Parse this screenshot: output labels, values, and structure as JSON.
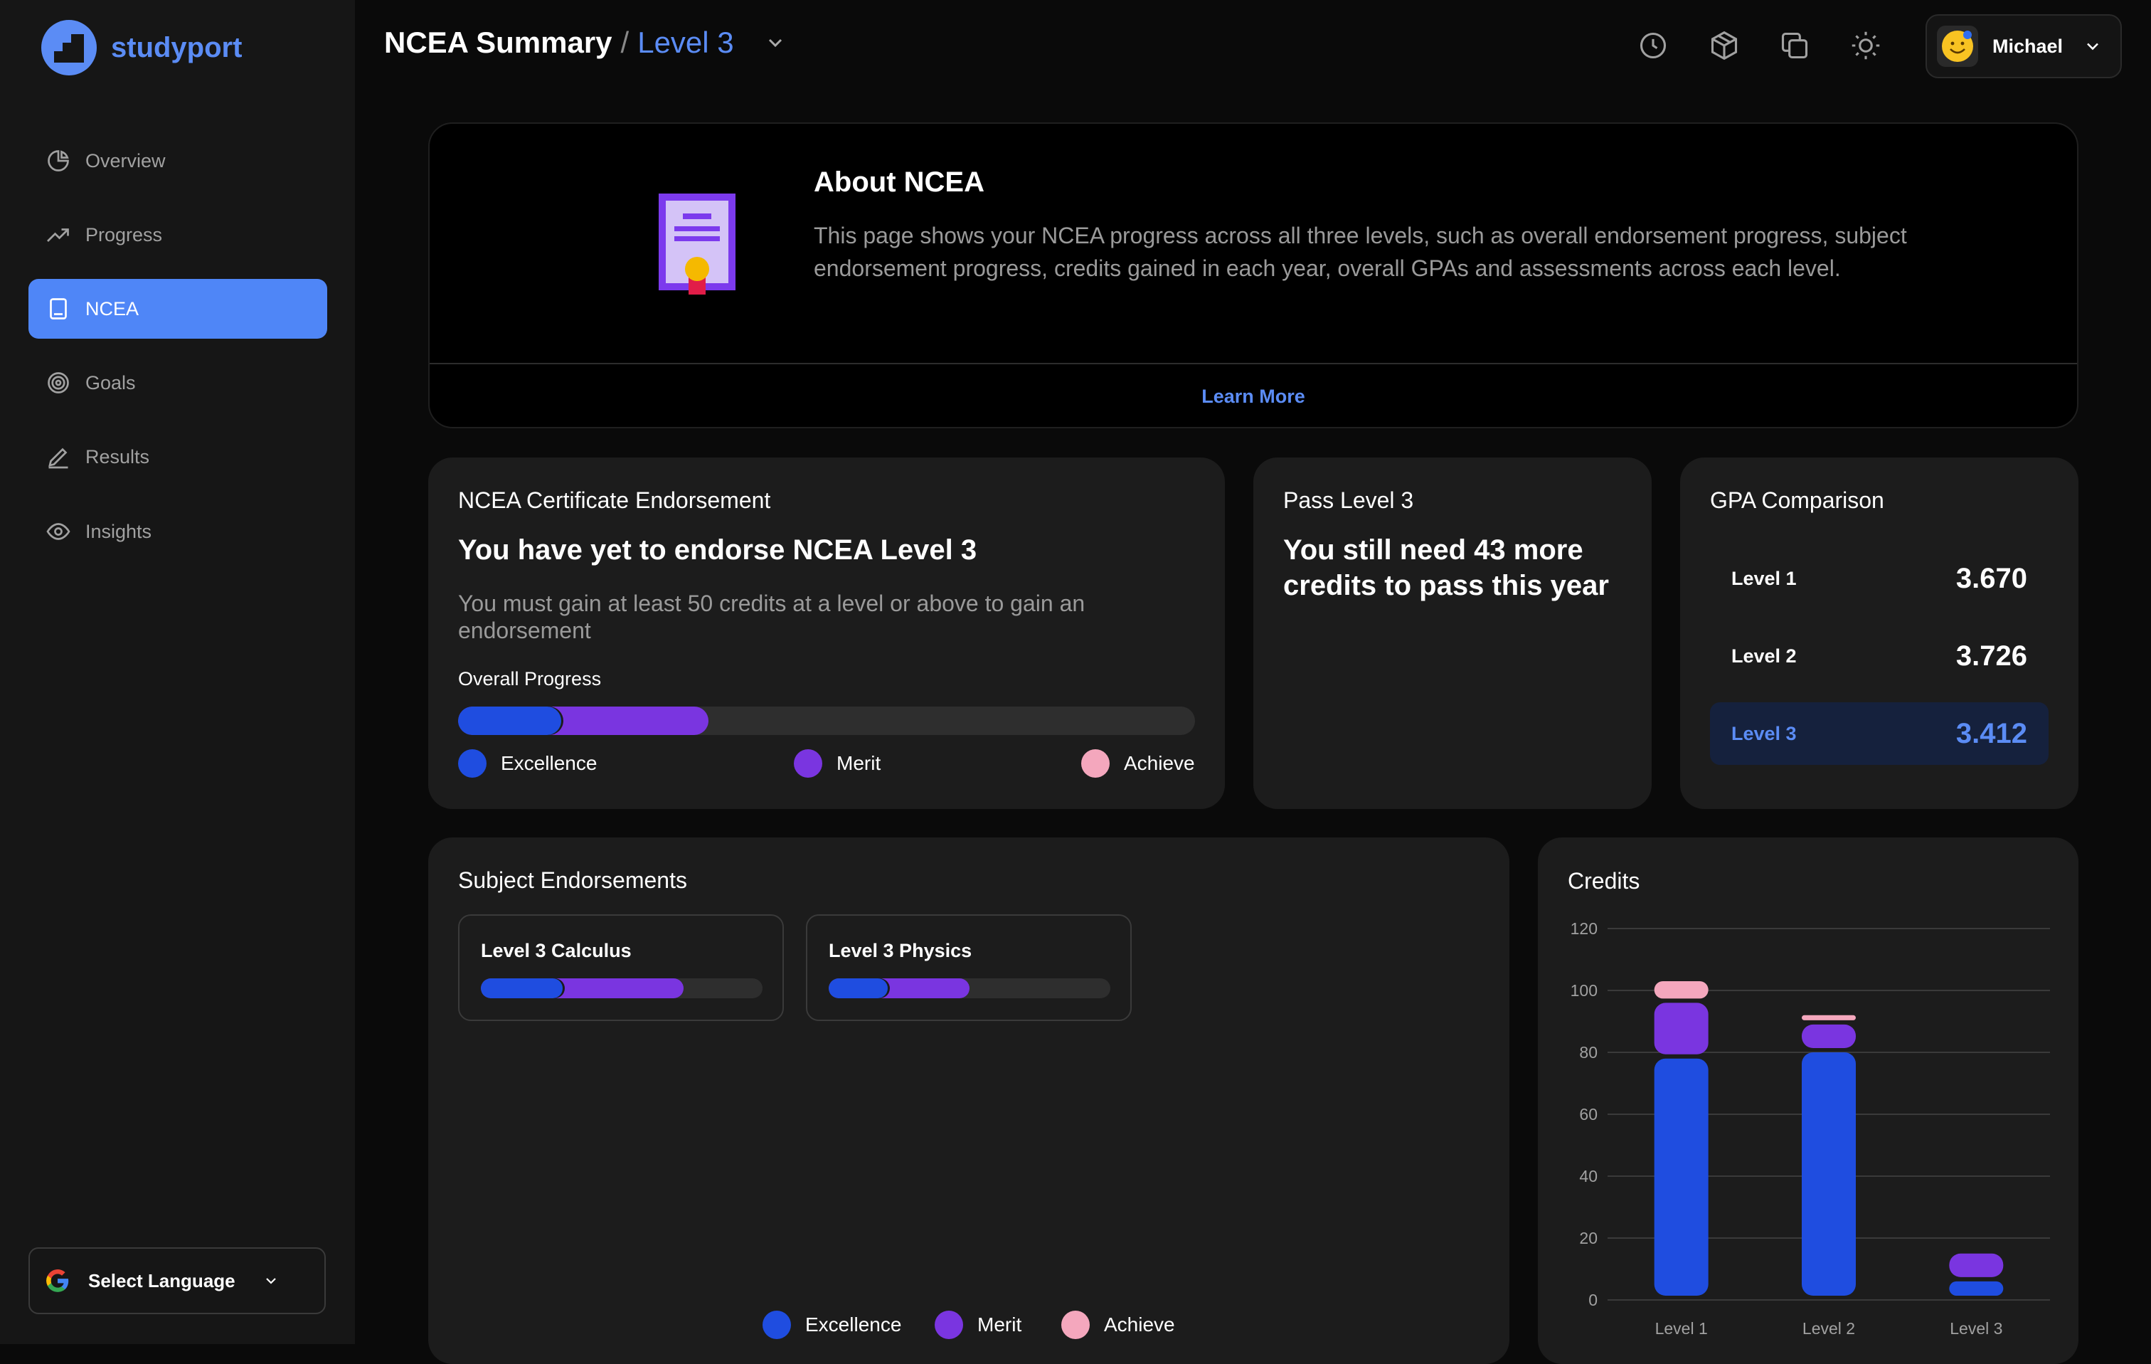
{
  "brand": {
    "name": "studyport"
  },
  "sidebar": {
    "items": [
      {
        "label": "Overview",
        "icon": "pie-chart-icon"
      },
      {
        "label": "Progress",
        "icon": "trending-up-icon"
      },
      {
        "label": "NCEA",
        "icon": "book-icon",
        "active": true
      },
      {
        "label": "Goals",
        "icon": "target-icon"
      },
      {
        "label": "Results",
        "icon": "pencil-icon"
      },
      {
        "label": "Insights",
        "icon": "eye-icon"
      }
    ],
    "language": "Select Language"
  },
  "header": {
    "title": "NCEA Summary",
    "separator": "/",
    "level": "Level 3",
    "user": "Michael"
  },
  "about": {
    "title": "About NCEA",
    "body": "This page shows your NCEA progress across all three levels, such as overall endorsement progress, subject endorsement progress, credits gained in each year, overall GPAs and assessments across each level.",
    "link": "Learn More"
  },
  "endorsement": {
    "title": "NCEA Certificate Endorsement",
    "headline": "You have yet to endorse NCEA Level 3",
    "note": "You must gain at least 50 credits at a level or above to gain an endorsement",
    "progress_label": "Overall Progress",
    "progress": {
      "excellence": 0.14,
      "merit": 0.2,
      "achieve": 0.0
    },
    "legend": [
      "Excellence",
      "Merit",
      "Achieve"
    ]
  },
  "pass": {
    "title": "Pass Level 3",
    "message": "You still need 43 more credits to pass this year"
  },
  "gpa": {
    "title": "GPA Comparison",
    "rows": [
      {
        "level": "Level 1",
        "value": "3.670"
      },
      {
        "level": "Level 2",
        "value": "3.726"
      },
      {
        "level": "Level 3",
        "value": "3.412",
        "selected": true
      }
    ]
  },
  "subjects": {
    "title": "Subject Endorsements",
    "items": [
      {
        "name": "Level 3 Calculus",
        "excellence": 0.29,
        "merit": 0.43
      },
      {
        "name": "Level 3 Physics",
        "excellence": 0.21,
        "merit": 0.29
      }
    ],
    "legend": [
      "Excellence",
      "Merit",
      "Achieve"
    ]
  },
  "colors": {
    "excellence": "#1f4de0",
    "merit": "#7a35e0",
    "achieve": "#f4a7bd",
    "accent": "#5b8cf5"
  },
  "chart_data": {
    "type": "bar",
    "title": "Credits",
    "stacked": true,
    "categories": [
      "Level 1",
      "Level 2",
      "Level 3"
    ],
    "series": [
      {
        "name": "Excellence",
        "values": [
          78,
          80,
          6
        ]
      },
      {
        "name": "Merit",
        "values": [
          18,
          9,
          9
        ]
      },
      {
        "name": "Achieve",
        "values": [
          7,
          3,
          0
        ]
      }
    ],
    "ylim": [
      0,
      120
    ],
    "yticks": [
      0,
      20,
      40,
      60,
      80,
      100,
      120
    ],
    "grid": true
  }
}
